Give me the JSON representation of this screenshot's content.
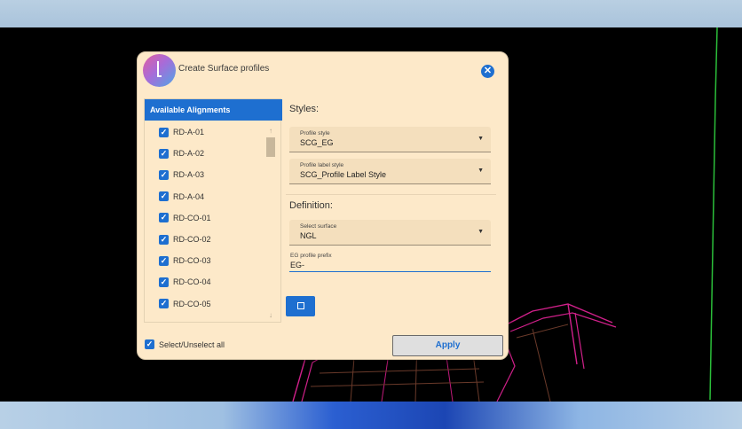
{
  "dialog": {
    "title": "Create Surface profiles",
    "close_glyph": "✕",
    "logo_icon": "app-logo-icon"
  },
  "alignments": {
    "header": "Available Alignments",
    "items": [
      {
        "label": "RD-A-01",
        "checked": true
      },
      {
        "label": "RD-A-02",
        "checked": true
      },
      {
        "label": "RD-A-03",
        "checked": true
      },
      {
        "label": "RD-A-04",
        "checked": true
      },
      {
        "label": "RD-CO-01",
        "checked": true
      },
      {
        "label": "RD-CO-02",
        "checked": true
      },
      {
        "label": "RD-CO-03",
        "checked": true
      },
      {
        "label": "RD-CO-04",
        "checked": true
      },
      {
        "label": "RD-CO-05",
        "checked": true
      }
    ],
    "scroll_up_glyph": "↑",
    "scroll_down_glyph": "↓"
  },
  "styles": {
    "heading": "Styles:",
    "profile_style": {
      "label": "Profile style",
      "value": "SCG_EG"
    },
    "profile_label_style": {
      "label": "Profile label style",
      "value": "SCG_Profile Label Style"
    }
  },
  "definition": {
    "heading": "Definition:",
    "select_surface": {
      "label": "Select surface",
      "value": "NGL"
    },
    "eg_prefix": {
      "label": "EG profile prefix",
      "value": "EG-"
    }
  },
  "footer": {
    "select_all_label": "Select/Unselect all",
    "select_all_checked": true,
    "apply_label": "Apply"
  },
  "glyphs": {
    "checkmark": "✓",
    "dropdown": "▼"
  },
  "colors": {
    "accent": "#1e6fd0",
    "dialog_bg": "#fde9c9",
    "cad_magenta": "#d0208a",
    "cad_green": "#2bbf3a"
  }
}
